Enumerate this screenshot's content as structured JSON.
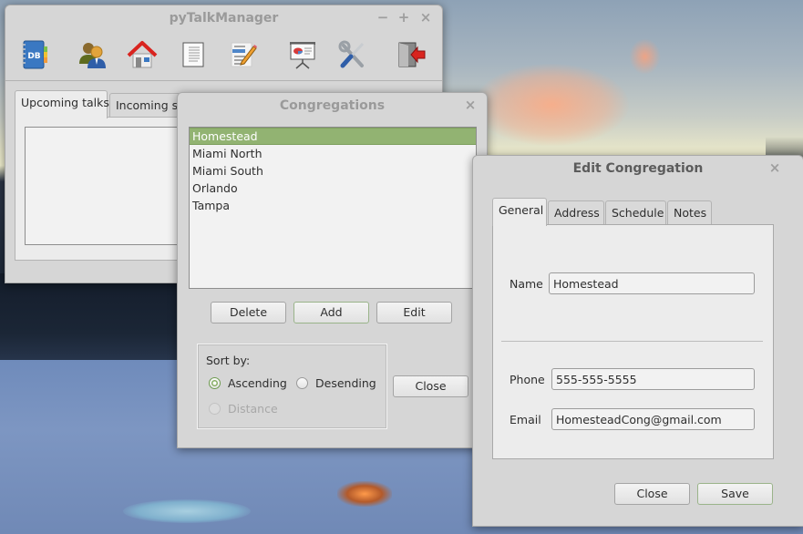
{
  "main_window": {
    "title": "pyTalkManager",
    "controls": {
      "minimize": "−",
      "maximize": "+",
      "close": "×"
    },
    "toolbar": [
      {
        "name": "database",
        "icon": "address-book-db-icon",
        "badge": "DB"
      },
      {
        "name": "speakers",
        "icon": "people-icon"
      },
      {
        "name": "congregations",
        "icon": "home-icon"
      },
      {
        "name": "outlines",
        "icon": "document-icon"
      },
      {
        "name": "edit-list",
        "icon": "list-edit-icon"
      },
      {
        "name": "presentation",
        "icon": "presentation-icon"
      },
      {
        "name": "settings",
        "icon": "tools-icon"
      },
      {
        "name": "exit",
        "icon": "exit-door-icon"
      }
    ],
    "tabs": [
      {
        "label": "Upcoming talks",
        "selected": true
      },
      {
        "label": "Incoming speakers",
        "selected": false
      }
    ]
  },
  "congregations_window": {
    "title": "Congregations",
    "close": "×",
    "list": [
      {
        "label": "Homestead",
        "selected": true
      },
      {
        "label": "Miami North",
        "selected": false
      },
      {
        "label": "Miami South",
        "selected": false
      },
      {
        "label": "Orlando",
        "selected": false
      },
      {
        "label": "Tampa",
        "selected": false
      }
    ],
    "buttons": {
      "delete": "Delete",
      "add": "Add",
      "edit": "Edit",
      "close": "Close"
    },
    "sort": {
      "label": "Sort by:",
      "options": [
        {
          "label": "Ascending",
          "checked": true,
          "enabled": true
        },
        {
          "label": "Desending",
          "checked": false,
          "enabled": true
        },
        {
          "label": "Distance",
          "checked": false,
          "enabled": false
        }
      ]
    }
  },
  "edit_window": {
    "title": "Edit Congregation",
    "close": "×",
    "tabs": [
      {
        "label": "General",
        "selected": true
      },
      {
        "label": "Address",
        "selected": false
      },
      {
        "label": "Schedule",
        "selected": false
      },
      {
        "label": "Notes",
        "selected": false
      }
    ],
    "fields": {
      "name": {
        "label": "Name",
        "value": "Homestead"
      },
      "phone": {
        "label": "Phone",
        "value": "555-555-5555"
      },
      "email": {
        "label": "Email",
        "value": "HomesteadCong@gmail.com"
      }
    },
    "buttons": {
      "close": "Close",
      "save": "Save"
    }
  },
  "colors": {
    "selection": "#92b372",
    "window_bg": "#d6d6d6",
    "pane_bg": "#ececec"
  }
}
